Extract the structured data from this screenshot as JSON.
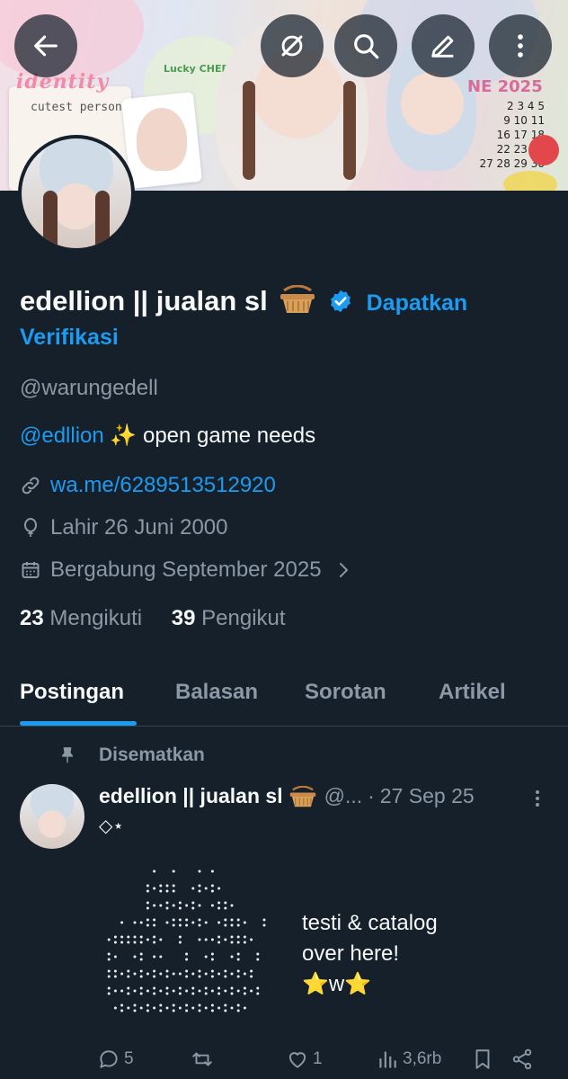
{
  "banner": {
    "identity": "identity",
    "cutest": "cutest person",
    "lucky": "Lucky CHERS",
    "month": "NE 2025",
    "calendar": [
      "2  3  4  5",
      "9 10 11",
      "16 17 18",
      "22 23 24",
      "27 28 29 30"
    ]
  },
  "header": {
    "back_icon": "arrow-left-icon",
    "grok_icon": "grok-icon",
    "search_icon": "search-icon",
    "edit_icon": "edit-icon",
    "more_icon": "more-vertical-icon"
  },
  "profile": {
    "display_name": "edellion || jualan sl",
    "name_emoji": "basket-emoji",
    "verify_prompt_1": "Dapatkan",
    "verify_prompt_2": "Verifikasi",
    "handle": "@warungedell",
    "bio_mention": "@edllion",
    "bio_sparkle": "✨",
    "bio_text": "open game needs",
    "website": "wa.me/6289513512920",
    "birth": "Lahir 26 Juni 2000",
    "joined": "Bergabung September 2025",
    "following_count": "23",
    "following_label": "Mengikuti",
    "followers_count": "39",
    "followers_label": "Pengikut"
  },
  "tabs": [
    {
      "label": "Postingan",
      "active": true
    },
    {
      "label": "Balasan",
      "active": false
    },
    {
      "label": "Sorotan",
      "active": false
    },
    {
      "label": "Artikel",
      "active": false
    }
  ],
  "post": {
    "pinned_label": "Disematkan",
    "author_name": "edellion || jualan sl",
    "author_handle": "@...",
    "dot": "·",
    "date": "27 Sep 25",
    "first_line": "◇⋆",
    "text_lines": [
      "testi & catalog",
      "over here!",
      "⭐w⭐"
    ],
    "replies": "5",
    "retweets": "",
    "likes": "1",
    "views": "3,6rb"
  },
  "colors": {
    "background": "#15202b",
    "accent": "#1d9bf0",
    "muted": "#8b98a5",
    "text": "#f7f9f9"
  }
}
